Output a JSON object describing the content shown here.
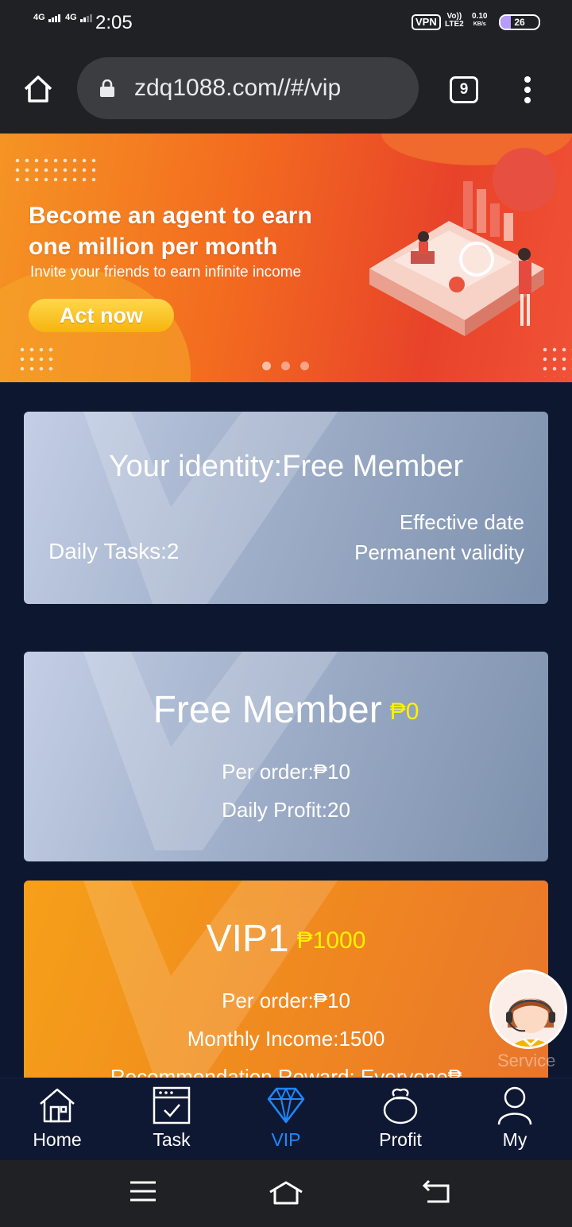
{
  "status_bar": {
    "signal1": "4G",
    "signal2": "4G",
    "time": "2:05",
    "vpn": "VPN",
    "volte_top": "Vo))",
    "volte_bottom": "LTE2",
    "net_speed": "0.10",
    "net_unit": "KB/s",
    "battery": "26"
  },
  "browser": {
    "url": "zdq1088.com//#/vip",
    "tab_count": "9",
    "icons": [
      "home-icon",
      "lock-icon",
      "tabs-icon",
      "more-vert-icon"
    ]
  },
  "banner": {
    "title_line1": "Become an agent to earn",
    "title_line2": "one million per month",
    "subtitle": "Invite your friends to earn infinite income",
    "cta": "Act now",
    "slide_count": 3,
    "active_slide": 1
  },
  "identity": {
    "title": "Your identity:Free Member",
    "daily_tasks": "Daily Tasks:2",
    "effective_label": "Effective date",
    "validity": "Permanent validity"
  },
  "levels": [
    {
      "name": "Free Member",
      "price": "₱0",
      "per_order": "Per order:₱10",
      "line2": "Daily Profit:20"
    },
    {
      "name": "VIP1",
      "price": "₱1000",
      "per_order": "Per order:₱10",
      "line2": "Monthly Income:1500",
      "line3": "Recommendation Reward: Everyone₱"
    }
  ],
  "service": {
    "label": "Service"
  },
  "bottom_nav": [
    {
      "label": "Home",
      "icon": "home-icon",
      "active": false
    },
    {
      "label": "Task",
      "icon": "task-icon",
      "active": false
    },
    {
      "label": "VIP",
      "icon": "diamond-icon",
      "active": true
    },
    {
      "label": "Profit",
      "icon": "money-bag-icon",
      "active": false
    },
    {
      "label": "My",
      "icon": "user-icon",
      "active": false
    }
  ],
  "colors": {
    "page_bg": "#0e1730",
    "accent": "#1e88ff",
    "price": "#fff200",
    "banner_orange": "#f36c1f",
    "vip1_orange": "#f08a1f"
  }
}
